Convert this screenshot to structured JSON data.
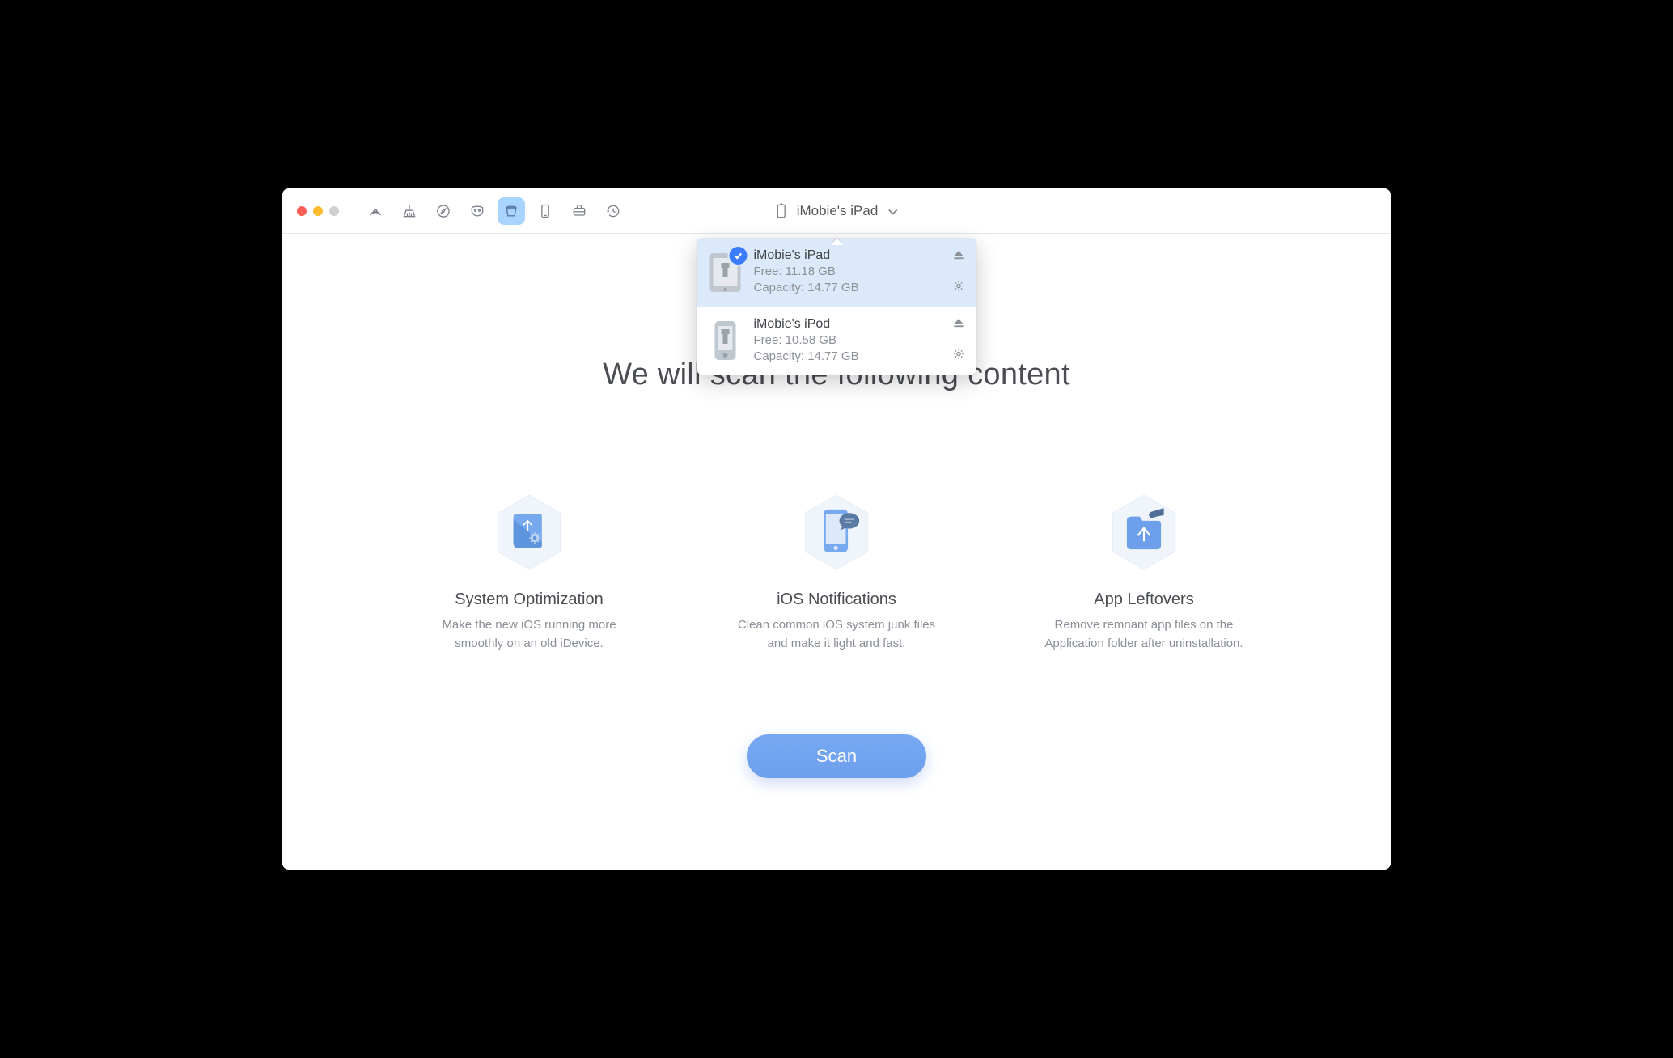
{
  "deviceSelector": {
    "current": "iMobie's iPad"
  },
  "dropdown": {
    "items": [
      {
        "name": "iMobie's iPad",
        "free": "Free: 11.18 GB",
        "capacity": "Capacity: 14.77 GB",
        "selected": true
      },
      {
        "name": "iMobie's iPod",
        "free": "Free: 10.58 GB",
        "capacity": "Capacity: 14.77 GB",
        "selected": false
      }
    ]
  },
  "headline": "We will scan the following content",
  "cards": [
    {
      "title": "System Optimization",
      "desc": "Make the new iOS running more smoothly on an old iDevice."
    },
    {
      "title": "iOS Notifications",
      "desc": "Clean common iOS system junk files and make it light and fast."
    },
    {
      "title": "App Leftovers",
      "desc": "Remove remnant app files on the Application folder after uninstallation."
    }
  ],
  "scanButton": "Scan"
}
